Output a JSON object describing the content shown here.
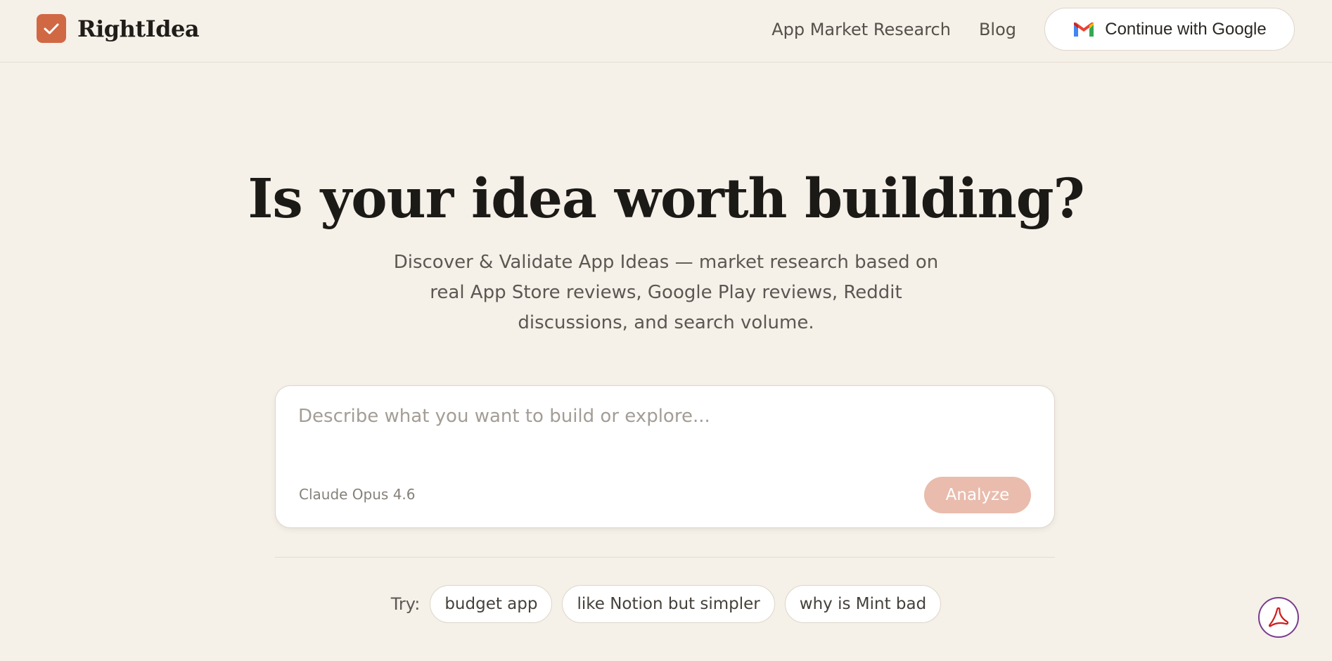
{
  "header": {
    "logo_text": "RightIdea",
    "nav": {
      "market_research": "App Market Research",
      "blog": "Blog",
      "google_button": "Continue with Google"
    }
  },
  "hero": {
    "headline": "Is your idea worth building?",
    "subtitle": "Discover & Validate App Ideas — market research based on real App Store reviews, Google Play reviews, Reddit discussions, and search volume."
  },
  "composer": {
    "placeholder": "Describe what you want to build or explore...",
    "value": "",
    "model": "Claude Opus 4.6",
    "analyze_label": "Analyze"
  },
  "suggestions": {
    "label": "Try:",
    "chips": [
      "budget app",
      "like Notion but simpler",
      "why is Mint bad"
    ]
  },
  "icons": {
    "logo": "checkmark-icon",
    "google": "gmail-icon",
    "floating": "acrobat-pdf-icon"
  },
  "colors": {
    "background": "#f5f0e8",
    "accent": "#d16844",
    "analyze_disabled": "#e9bcad",
    "pdf_ring": "#7a3b8f"
  }
}
